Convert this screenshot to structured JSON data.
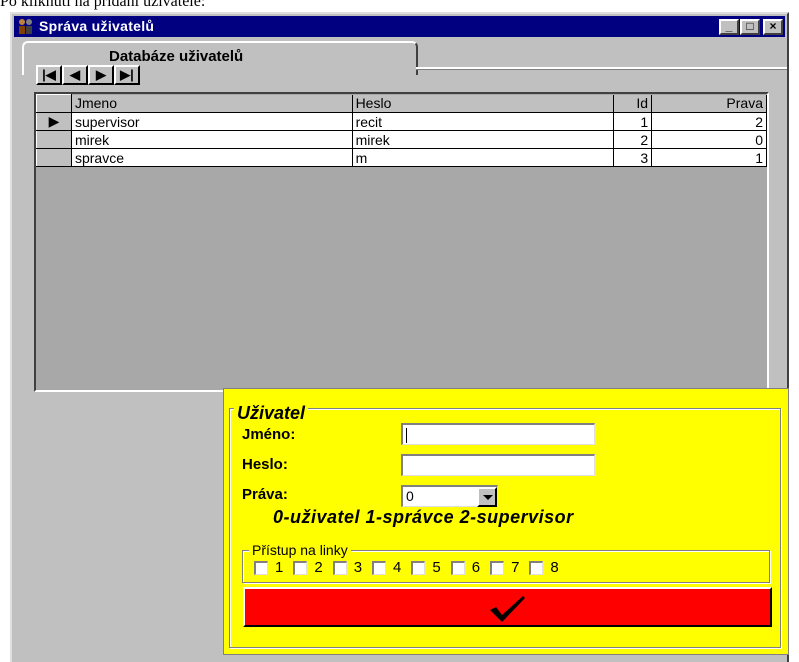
{
  "caption": "Po kliknutí na přidání uživatele:",
  "window": {
    "title": "Správa uživatelů"
  },
  "tab": {
    "label": "Databáze uživatelů"
  },
  "nav": {
    "first": "|◀",
    "prev": "◀",
    "next": "▶",
    "last": "▶|"
  },
  "grid": {
    "columns": [
      "Jmeno",
      "Heslo",
      "Id",
      "Prava"
    ],
    "rows": [
      {
        "jmeno": "supervisor",
        "heslo": "recit",
        "id": "1",
        "prava": "2"
      },
      {
        "jmeno": "mirek",
        "heslo": "mirek",
        "id": "2",
        "prava": "0"
      },
      {
        "jmeno": "spravce",
        "heslo": "m",
        "id": "3",
        "prava": "1"
      }
    ]
  },
  "form": {
    "group_title": "Uživatel",
    "jmeno_label": "Jméno:",
    "jmeno_value": "",
    "heslo_label": "Heslo:",
    "heslo_value": "",
    "prava_label": "Práva:",
    "prava_value": "0",
    "rights_legend": "0-uživatel 1-správce 2-supervisor",
    "lines_group_title": "Přístup na linky",
    "lines": [
      "1",
      "2",
      "3",
      "4",
      "5",
      "6",
      "7",
      "8"
    ],
    "submit_icon": "checkmark-icon"
  },
  "colors": {
    "panel": "#ffff00",
    "submit": "#ff0000",
    "titlebar": "#000080"
  }
}
